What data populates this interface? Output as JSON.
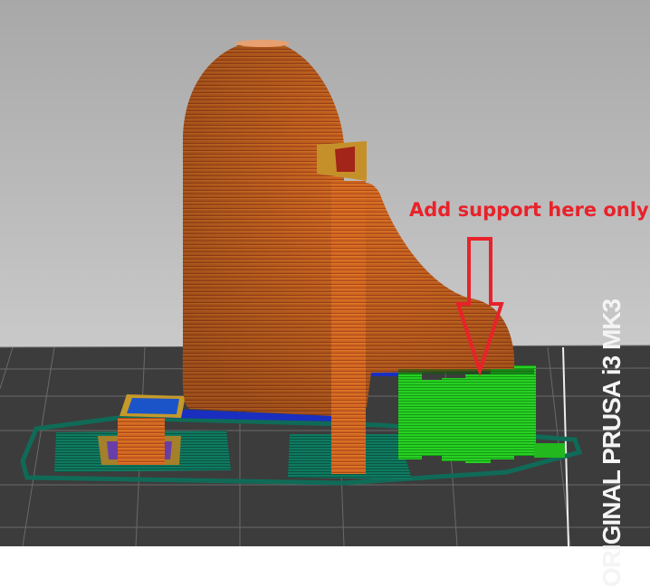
{
  "annotation": {
    "text": "Add support here only",
    "color": "#e8222a"
  },
  "bed": {
    "label": "ORIGINAL PRUSA i3 MK3",
    "color": "#3c3c3c"
  },
  "colors": {
    "background_top": "#a9a9a9",
    "background_bottom": "#c9c9c9",
    "perimeter": "#d2651f",
    "support": "#22c81e",
    "skirt": "#0f6b57",
    "wipe": "#1a2fc0"
  }
}
